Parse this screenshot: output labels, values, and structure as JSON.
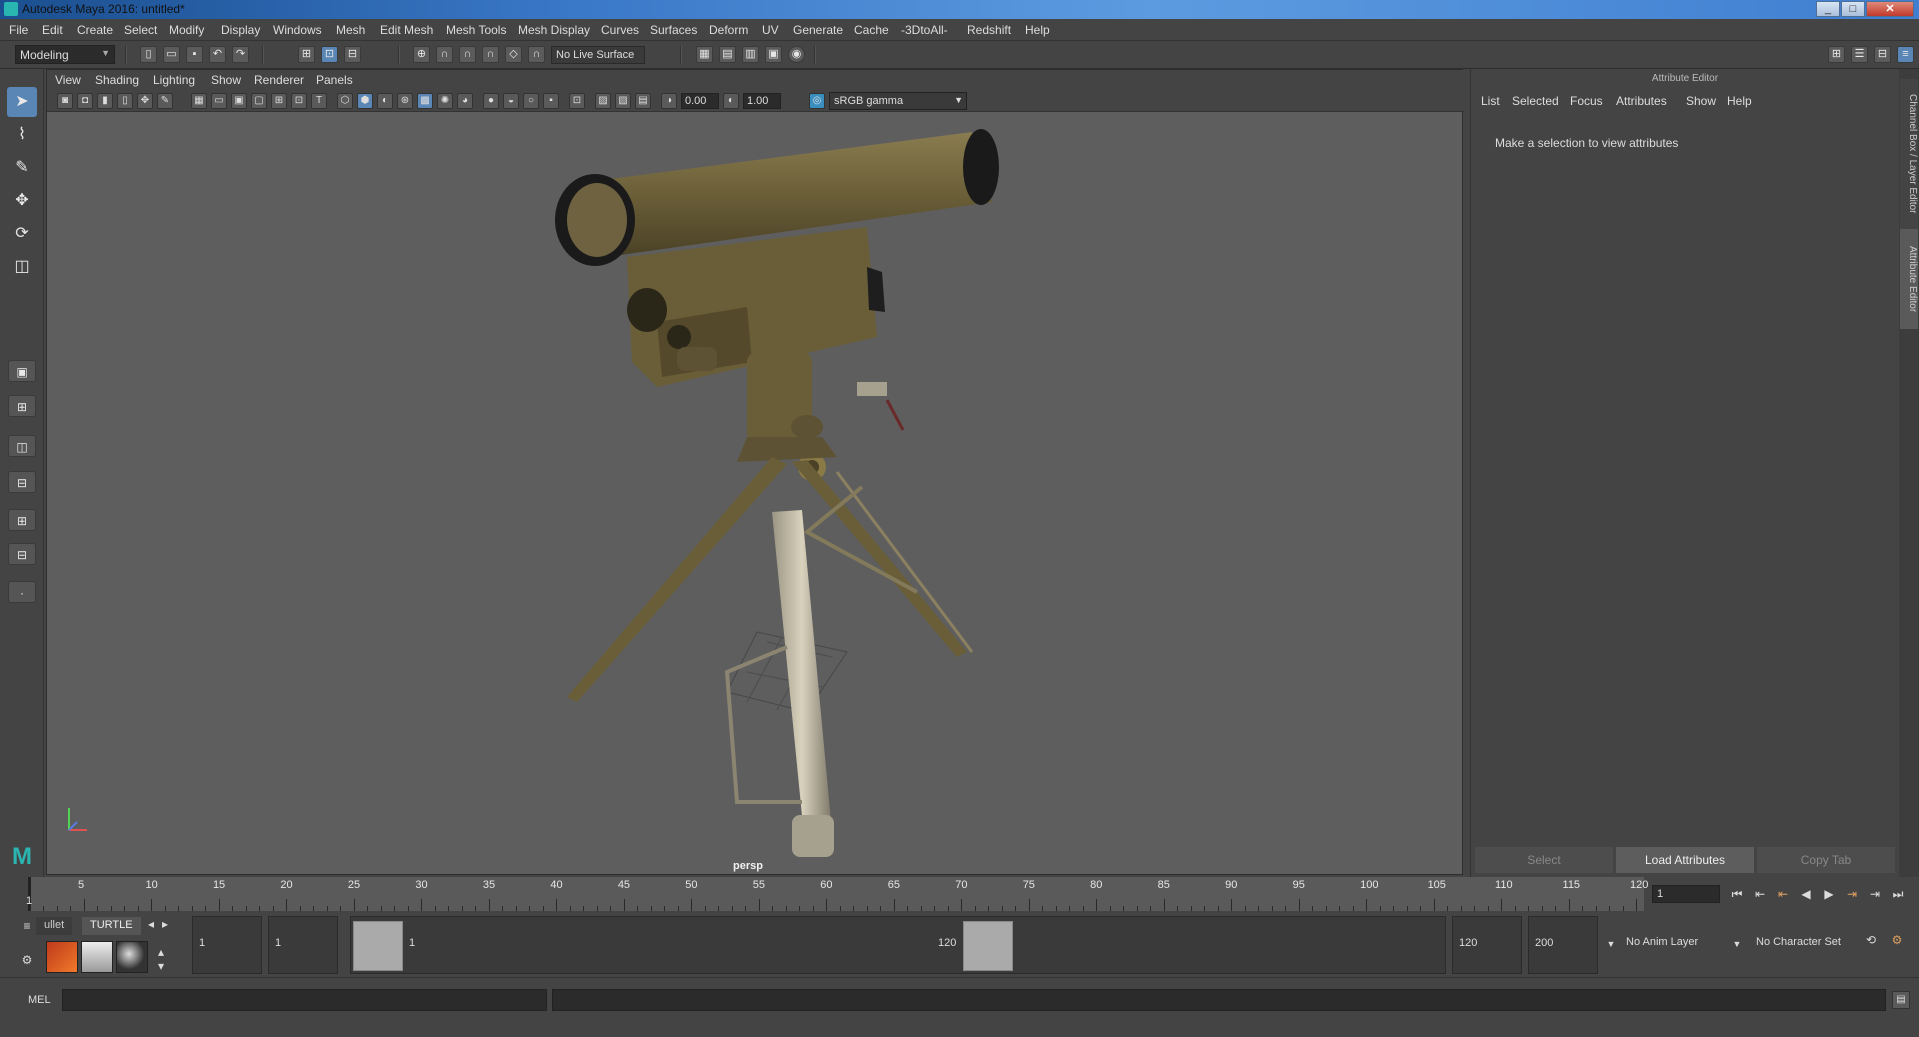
{
  "window": {
    "title": "Autodesk Maya 2016: untitled*"
  },
  "menubar": [
    "File",
    "Edit",
    "Create",
    "Select",
    "Modify",
    "Display",
    "Windows",
    "Mesh",
    "Edit Mesh",
    "Mesh Tools",
    "Mesh Display",
    "Curves",
    "Surfaces",
    "Deform",
    "UV",
    "Generate",
    "Cache",
    "-3DtoAll-",
    "Redshift",
    "Help"
  ],
  "statusline": {
    "mode": "Modeling",
    "live_surface": "No Live Surface"
  },
  "panel": {
    "menu": [
      "View",
      "Shading",
      "Lighting",
      "Show",
      "Renderer",
      "Panels"
    ],
    "exposure": "0.00",
    "gamma": "1.00",
    "color_space": "sRGB gamma",
    "camera": "persp"
  },
  "attribute_editor": {
    "title": "Attribute Editor",
    "menu": [
      "List",
      "Selected",
      "Focus",
      "Attributes",
      "Show",
      "Help"
    ],
    "message": "Make a selection to view attributes",
    "buttons": [
      "Select",
      "Load Attributes",
      "Copy Tab"
    ],
    "side_tabs": [
      "Channel Box / Layer Editor",
      "Attribute Editor"
    ]
  },
  "timeslider": {
    "ticks": [
      5,
      10,
      15,
      20,
      25,
      30,
      35,
      40,
      45,
      50,
      55,
      60,
      65,
      70,
      75,
      80,
      85,
      90,
      95,
      100,
      105,
      110,
      115,
      120
    ],
    "start_label": "1",
    "current_frame": "1"
  },
  "shelf": {
    "tabs": [
      "ullet",
      "TURTLE"
    ]
  },
  "range": {
    "start": "1",
    "playback_start": "1",
    "handle_start": "1",
    "handle_end": "120",
    "playback_end": "120",
    "end": "200",
    "anim_layer": "No Anim Layer",
    "character_set": "No Character Set"
  },
  "cmdline": {
    "label": "MEL"
  }
}
